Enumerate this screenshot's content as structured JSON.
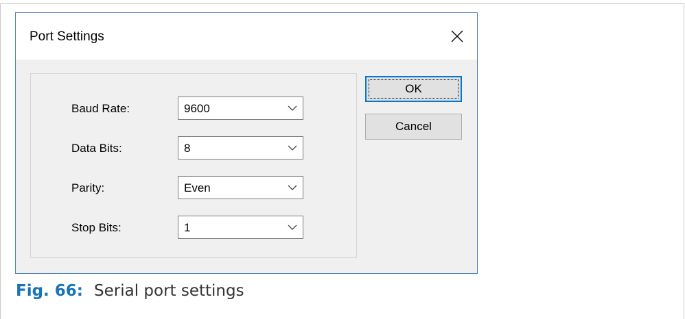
{
  "dialog": {
    "title": "Port Settings",
    "close_icon": "close-icon"
  },
  "fields": [
    {
      "label": "Baud Rate:",
      "value": "9600"
    },
    {
      "label": "Data Bits:",
      "value": "8"
    },
    {
      "label": "Parity:",
      "value": "Even"
    },
    {
      "label": "Stop Bits:",
      "value": "1"
    }
  ],
  "buttons": {
    "ok_label": "OK",
    "cancel_label": "Cancel"
  },
  "caption": {
    "number": "Fig. 66:",
    "text": "Serial port settings"
  },
  "colors": {
    "accent": "#0078d7",
    "caption_number": "#1a73b5",
    "dialog_border": "#4a7fbf"
  }
}
